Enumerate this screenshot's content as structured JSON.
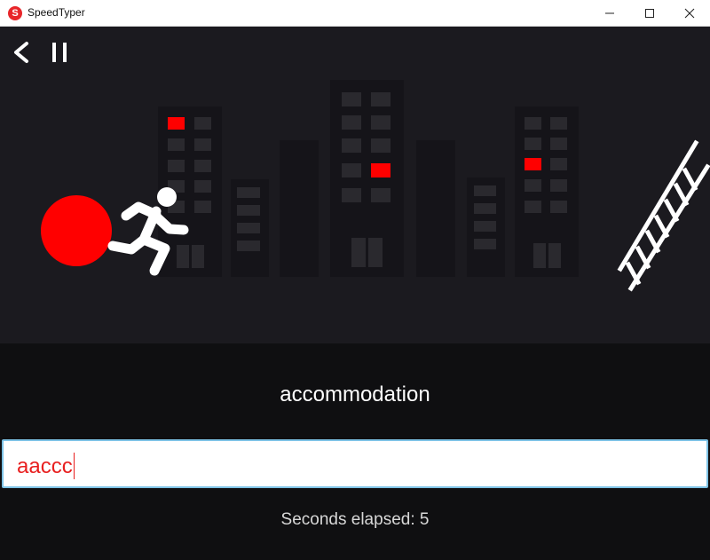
{
  "window": {
    "title": "SpeedTyper",
    "icon_letter": "S",
    "icon_color": "#e8262a",
    "controls": [
      "minimize-icon",
      "maximize-icon",
      "close-icon"
    ]
  },
  "game": {
    "controls": [
      "back-icon",
      "pause-icon"
    ],
    "scene_background": "#1b1a1f",
    "building_color": "#151419",
    "window_color": "#2a292e",
    "lit_window_color": "#ff0000",
    "ball_color": "#ff0000",
    "runner_color": "#ffffff",
    "ladder_color": "#ffffff"
  },
  "typing": {
    "target_word": "accommodation",
    "input_value": "aaccc",
    "input_text_color": "#e81f1f",
    "input_border_color": "#7ec3e6"
  },
  "status": {
    "elapsed_text": "Seconds elapsed: 5"
  }
}
